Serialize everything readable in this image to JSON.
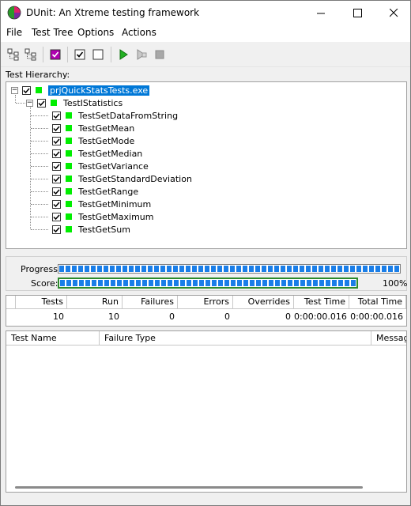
{
  "window": {
    "title": "DUnit: An Xtreme testing framework",
    "controls": {
      "minimize": "—",
      "maximize": "☐",
      "close": "✕"
    }
  },
  "menu": {
    "items": [
      "File",
      "Test Tree",
      "Options",
      "Actions"
    ]
  },
  "toolbar": {
    "icons": [
      "expand-all-icon",
      "collapse-all-icon",
      "select-all-icon",
      "check-icon",
      "uncheck-icon",
      "run-icon",
      "run-selected-icon",
      "stop-icon"
    ]
  },
  "tree": {
    "label": "Test Hierarchy:",
    "root": "prjQuickStatsTests.exe",
    "suite": "TestIStatistics",
    "tests": [
      "TestSetDataFromString",
      "TestGetMean",
      "TestGetMode",
      "TestGetMedian",
      "TestGetVariance",
      "TestGetStandardDeviation",
      "TestGetRange",
      "TestGetMinimum",
      "TestGetMaximum",
      "TestGetSum"
    ]
  },
  "progress": {
    "progress_label": "Progress:",
    "score_label": "Score:",
    "progress_value": 1.0,
    "score_value": 1.0,
    "score_text": "100%"
  },
  "stats": {
    "headers": [
      "Tests",
      "Run",
      "Failures",
      "Errors",
      "Overrides",
      "Test Time",
      "Total Time"
    ],
    "values": [
      "10",
      "10",
      "0",
      "0",
      "0",
      "0:00:00.016",
      "0:00:00.016"
    ]
  },
  "failures": {
    "headers": [
      "Test Name",
      "Failure Type",
      "Messag"
    ]
  },
  "colors": {
    "pass_green": "#00ee00",
    "selection_blue": "#0078d7",
    "progress_blue": "#1a7ee8",
    "score_border_green": "#2c8a2c"
  }
}
